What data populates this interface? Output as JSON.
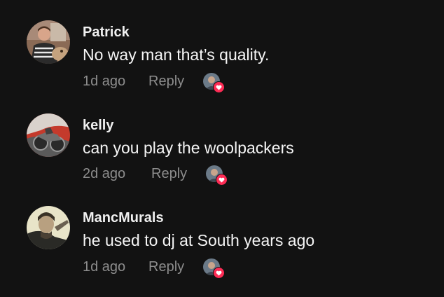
{
  "comments": [
    {
      "username": "Patrick",
      "text": "No way man that’s quality.",
      "time": "1d ago",
      "reply_label": "Reply",
      "liked_by_creator": true
    },
    {
      "username": "kelly",
      "text": "can you play the woolpackers",
      "time": "2d ago",
      "reply_label": "Reply",
      "liked_by_creator": true
    },
    {
      "username": "MancMurals",
      "text": "he used to dj at South years ago",
      "time": "1d ago",
      "reply_label": "Reply",
      "liked_by_creator": true
    }
  ],
  "colors": {
    "background": "#121212",
    "primary_text": "#f2f2f2",
    "secondary_text": "#8d8d8d",
    "heart": "#fe2c55"
  },
  "icons": {
    "avatar": "user-avatar-photo",
    "liked": "heart-icon"
  }
}
